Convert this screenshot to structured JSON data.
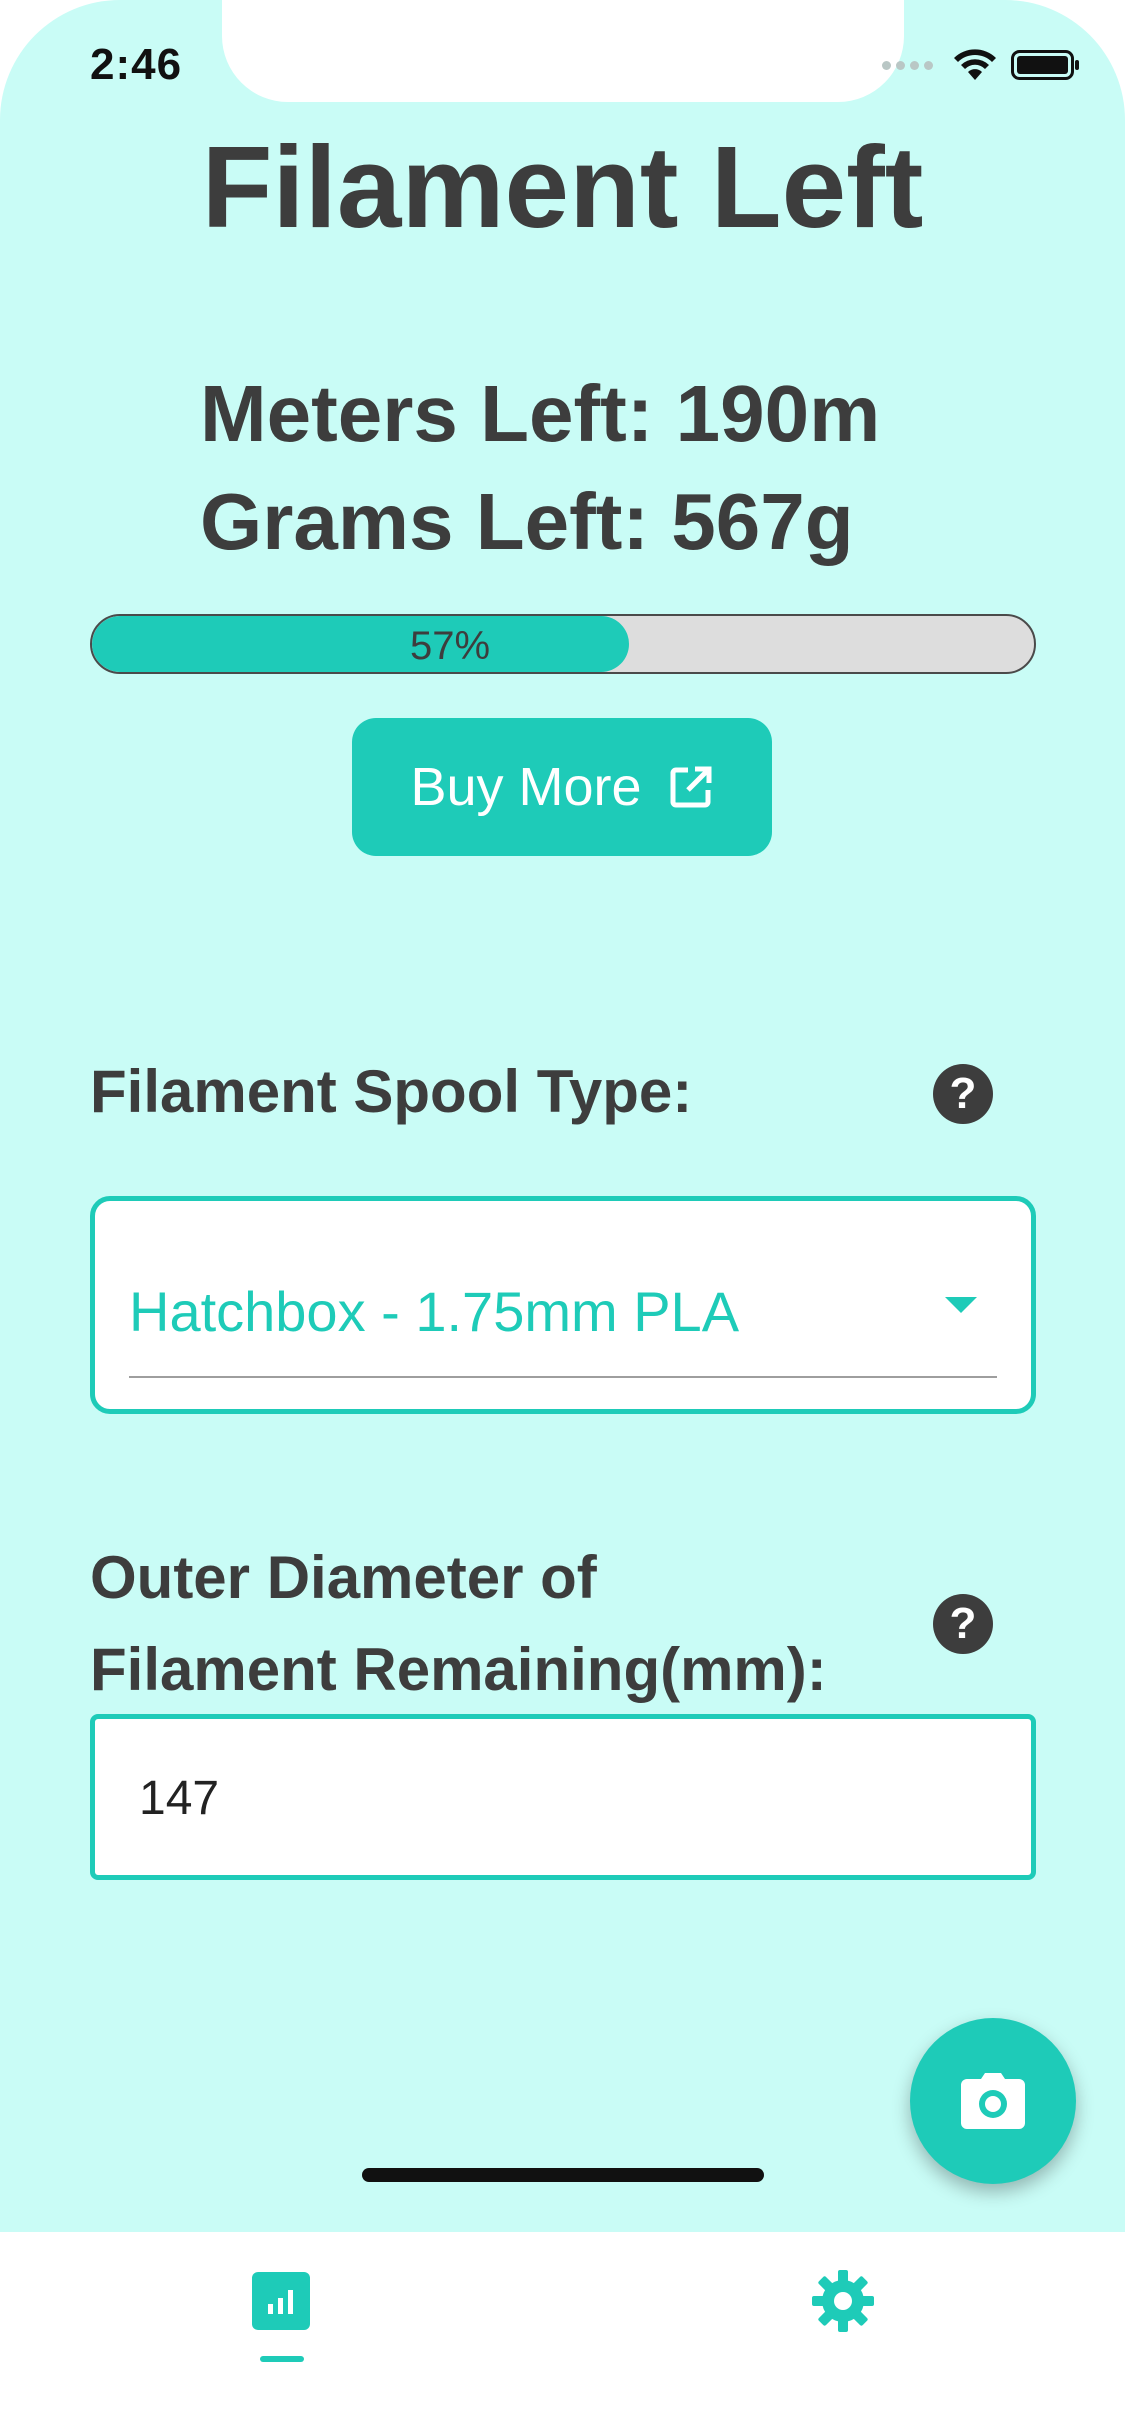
{
  "status_bar": {
    "time": "2:46"
  },
  "page": {
    "title": "Filament Left"
  },
  "stats": {
    "meters_left": "Meters Left: 190m",
    "grams_left": "Grams Left: 567g"
  },
  "progress": {
    "percent": 57,
    "label": "57%"
  },
  "buy_button": {
    "label": "Buy More",
    "icon": "external-link-icon"
  },
  "spool_type": {
    "label": "Filament Spool Type:",
    "selected": "Hatchbox - 1.75mm PLA",
    "help_symbol": "?"
  },
  "outer_diameter": {
    "label_line1": "Outer Diameter of",
    "label_line2": "Filament Remaining(mm):",
    "value": "147",
    "help_symbol": "?"
  },
  "fab": {
    "icon": "camera-icon"
  },
  "tabs": [
    {
      "icon": "stats-icon",
      "active": true
    },
    {
      "icon": "gear-icon",
      "active": false
    }
  ],
  "colors": {
    "accent": "#1ecbb8",
    "background": "#c9fcf6",
    "text": "#3d3d3d"
  }
}
